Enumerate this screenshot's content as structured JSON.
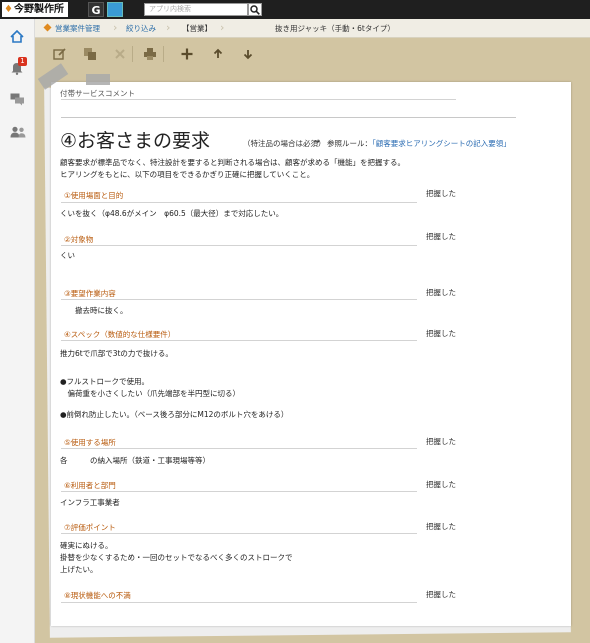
{
  "topbar": {
    "logo_text": "今野製作所",
    "g_label": "G",
    "search_placeholder": "アプリ内検索"
  },
  "rail": {
    "notification_count": "1"
  },
  "breadcrumb": {
    "items": [
      "営業案件管理",
      "絞り込み",
      "【営業】",
      "抜き用ジャッキ（手動・6tタイプ）"
    ]
  },
  "document": {
    "prev_section_label": "付帯サービスコメント",
    "heading": "④お客さまの要求",
    "heading_note": "（特注品の場合は必須）",
    "arrow": "→",
    "ref_prefix": "参照ルール：",
    "ref_link": "「顧客要求ヒアリングシートの記入要領」",
    "intro": [
      "顧客要求が標準品でなく、特注設計を要すると判断される場合は、顧客が求める「機能」を把握する。",
      "ヒアリングをもとに、以下の項目をできるかぎり正確に把握していくこと。"
    ],
    "sections": [
      {
        "label": "①使用場面と目的",
        "ack": "把握した",
        "lines": [
          "くいを抜く（φ48.6がメイン　φ60.5（最大径）まで対応したい。"
        ]
      },
      {
        "label": "②対象物",
        "ack": "把握した",
        "lines": [
          "くい"
        ]
      },
      {
        "label": "③要望作業内容",
        "ack": "把握した",
        "lines": [
          "　　撤去時に抜く。"
        ]
      },
      {
        "label": "④スペック（数値的な仕様要件）",
        "ack": "把握した",
        "lines": [
          "推力6tで爪部で3tの力で抜ける。",
          "",
          "●フルストロークで使用。",
          "　偏荷重を小さくしたい（爪先端部を半円型に切る）",
          "",
          "●前倒れ防止したい。（ベース後ろ部分にM12のボルト穴をあける）"
        ]
      },
      {
        "label": "⑤使用する場所",
        "ack": "把握した",
        "lines": [
          "各　　　の納入場所（鉄道・工事現場等等）"
        ]
      },
      {
        "label": "⑥利用者と部門",
        "ack": "把握した",
        "lines": [
          "インフラ工事業者"
        ]
      },
      {
        "label": "⑦評価ポイント",
        "ack": "把握した",
        "lines": [
          "確実にぬける。",
          "掛替を少なくするため・一回のセットでなるべく多くのストロークで",
          "上げたい。"
        ]
      },
      {
        "label": "⑧現状機能への不満",
        "ack": "把握した",
        "lines": []
      }
    ]
  }
}
